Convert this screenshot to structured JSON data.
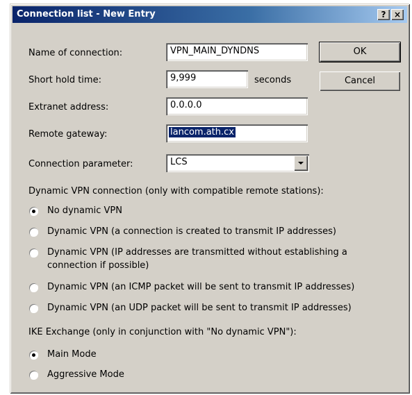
{
  "window": {
    "title": "Connection list - New Entry",
    "help_glyph": "?",
    "close_glyph": "×"
  },
  "form": {
    "name_label": "Name of connection:",
    "name_value": "VPN_MAIN_DYNDNS",
    "hold_label": "Short hold time:",
    "hold_value": "9,999",
    "hold_unit": "seconds",
    "extranet_label": "Extranet address:",
    "extranet_value": "0.0.0.0",
    "gateway_label": "Remote gateway:",
    "gateway_value": "lancom.ath.cx",
    "param_label": "Connection parameter:",
    "param_value": "LCS"
  },
  "buttons": {
    "ok": "OK",
    "cancel": "Cancel"
  },
  "dynamic_vpn": {
    "heading": "Dynamic VPN connection (only with compatible remote stations):",
    "options": [
      {
        "label": "No dynamic VPN",
        "checked": true
      },
      {
        "label": "Dynamic VPN (a connection is created to transmit IP addresses)",
        "checked": false
      },
      {
        "label": "Dynamic VPN (IP addresses are transmitted without establishing a",
        "label2": "connection if possible)",
        "checked": false
      },
      {
        "label": "Dynamic VPN (an ICMP packet will be sent to transmit IP addresses)",
        "checked": false
      },
      {
        "label": "Dynamic VPN (an UDP packet will be sent to transmit IP addresses)",
        "checked": false
      }
    ]
  },
  "ike": {
    "heading": "IKE Exchange (only in conjunction with \"No dynamic VPN\"):",
    "options": [
      {
        "label": "Main Mode",
        "checked": true
      },
      {
        "label": "Aggressive Mode",
        "checked": false
      }
    ]
  },
  "colors": {
    "title_bar_start": "#0a246a",
    "title_bar_end": "#a6caf0",
    "dialog_face": "#d4d0c8",
    "selection": "#0a246a"
  }
}
